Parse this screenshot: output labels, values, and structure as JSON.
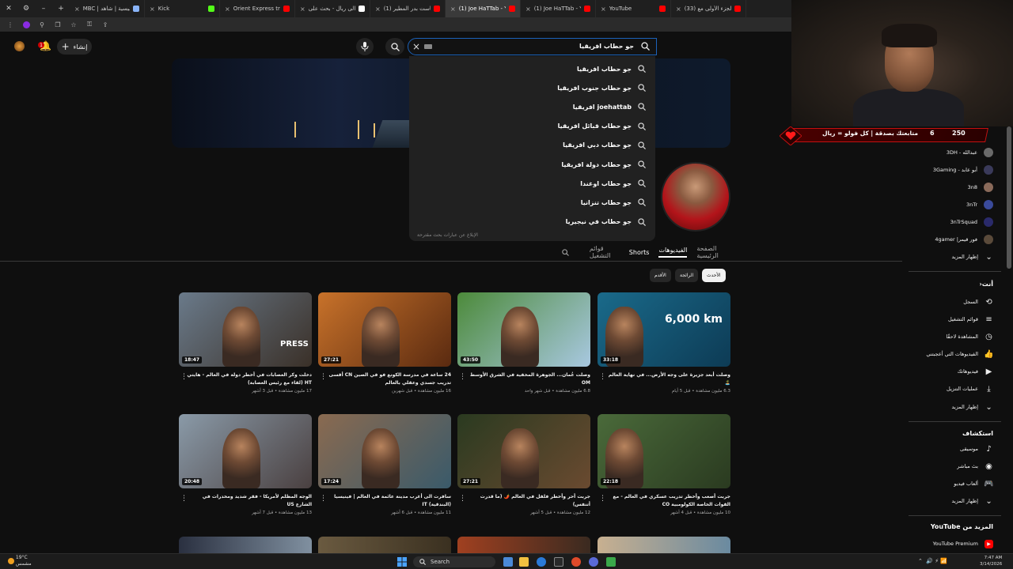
{
  "browser": {
    "tabs": [
      {
        "label": "MBC | الرئيسية | شاهد",
        "color": "#8ab4f8"
      },
      {
        "label": "Kick",
        "color": "#53fc18"
      },
      {
        "label": "Orient Express train li",
        "color": "#ff0000"
      },
      {
        "label": "يورو الى ريال - بحث على",
        "color": "#ffffff"
      },
      {
        "label": "(1) بودكاست بدر المطير",
        "color": "#ff0000"
      },
      {
        "label": "(1) Joe HaTTab - YouTu",
        "color": "#ff0000",
        "active": true
      },
      {
        "label": "(1) Joe HaTTab - YouTu",
        "color": "#ff0000"
      },
      {
        "label": "YouTube",
        "color": "#ff0000"
      },
      {
        "label": "(33) الجزء الأولى مع ...",
        "color": "#ff0000"
      }
    ]
  },
  "header": {
    "create_label": "إنشاء",
    "notif_count": "1"
  },
  "search": {
    "query": "جو حطاب افريقيا",
    "suggestions": [
      "جو حطاب افريقيا",
      "جو حطاب جنوب افريقيا",
      "joehattab افريقيا",
      "جو حطاب قبائل افريقيا",
      "جو حطاب دبي افريقيا",
      "جو حطاب دولة افريقيا",
      "جو حطاب اوغندا",
      "جو حطاب تنزانيا",
      "جو حطاب في نيجيريا"
    ],
    "report_label": "الإبلاغ عن عبارات بحث مقترحة"
  },
  "channel_tabs": [
    "الصفحة الرئيسية",
    "الفيديوهات",
    "Shorts",
    "قوائم التشغيل"
  ],
  "filters": [
    "الأحدث",
    "الرائجة",
    "الأقدم"
  ],
  "videos": [
    {
      "title": "وصلت أبعد جزيرة على وجه الأرض... في نهاية العالم 🏝️",
      "meta": "6.3 مليون مشاهدة • قبل 5 أيام",
      "duration": "33:18",
      "overlay": "6,000 km",
      "colors": [
        "#1a6a8a",
        "#0d3b55"
      ]
    },
    {
      "title": "وصلت عُمان... الجوهرة المخفية في الشرق الأوسط OM",
      "meta": "6.8 مليون مشاهدة • قبل شهر واحد",
      "duration": "43:50",
      "overlay": "",
      "colors": [
        "#4c8a3a",
        "#a8c8e0"
      ]
    },
    {
      "title": "24 ساعة في مدرسة الكونغ فو في الصين CN أقسى تدريب جسدي وعقلي بالعالم",
      "meta": "16 مليون مشاهدة • قبل شهرين",
      "duration": "27:21",
      "overlay": "",
      "colors": [
        "#c8722a",
        "#5a2a10"
      ]
    },
    {
      "title": "دخلت وكر العصابات في أخطر دولة في العالم - هايتي HT (لقاء مع رئيس العصابة)",
      "meta": "17 مليون مشاهدة • قبل 3 أشهر",
      "duration": "18:47",
      "overlay": "PRESS",
      "colors": [
        "#6a7a8a",
        "#3a3028"
      ]
    },
    {
      "title": "جربت أصعب وأخطر تدريب عسكري في العالم - مع القوات الخاصة الكولومبية CO",
      "meta": "10 مليون مشاهدة • قبل 4 أشهر",
      "duration": "22:18",
      "overlay": "",
      "colors": [
        "#4a6a3a",
        "#2a3a20"
      ]
    },
    {
      "title": "جربت أحر وأخطر فلفل في العالم 🌶️ (ما قدرت أتنفس)",
      "meta": "12 مليون مشاهدة • قبل 5 أشهر",
      "duration": "27:21",
      "overlay": "",
      "colors": [
        "#2a3a20",
        "#6a4a30"
      ]
    },
    {
      "title": "سافرت الى أغرب مدينة عائمة في العالم | فينيسيا (البندقية) IT",
      "meta": "11 مليون مشاهدة • قبل 6 أشهر",
      "duration": "17:24",
      "overlay": "",
      "colors": [
        "#8a6a50",
        "#3a5a6a"
      ]
    },
    {
      "title": "الوجه المظلم لأمريكا - فقر شديد ومخدرات في الشارع US",
      "meta": "13 مليون مشاهدة • قبل 7 أشهر",
      "duration": "20:48",
      "overlay": "",
      "colors": [
        "#8a9aa8",
        "#4a4040"
      ]
    }
  ],
  "sidebar": {
    "subs": [
      {
        "label": "عبدالله - 3DH",
        "color": "#6a6a6a"
      },
      {
        "label": "أبو عابد - 3Gaming",
        "color": "#3a3a5a"
      },
      {
        "label": "3n8",
        "color": "#8a6a5a"
      },
      {
        "label": "3nTr",
        "color": "#3a4a9a"
      },
      {
        "label": "3nTrSquad",
        "color": "#2a2a6a"
      },
      {
        "label": "فور قيمر| 4gamer",
        "color": "#5a4a3a"
      }
    ],
    "show_more": "إظهار المزيد",
    "you_heading": "أنت",
    "you_items": [
      {
        "label": "السجل",
        "icon": "history-icon"
      },
      {
        "label": "قوائم التشغيل",
        "icon": "playlists-icon"
      },
      {
        "label": "المشاهدة لاحقًا",
        "icon": "watch-later-icon"
      },
      {
        "label": "الفيديوهات التي أعجبتني",
        "icon": "like-icon"
      },
      {
        "label": "فيديوهاتك",
        "icon": "your-videos-icon"
      },
      {
        "label": "عمليات التنزيل",
        "icon": "download-icon"
      }
    ],
    "explore_heading": "استكشاف",
    "explore_items": [
      {
        "label": "موسيقى",
        "icon": "music-icon"
      },
      {
        "label": "بث مباشر",
        "icon": "live-icon"
      },
      {
        "label": "ألعاب فيديو",
        "icon": "gaming-icon"
      }
    ],
    "more_heading": "المزيد من YouTube",
    "premium": "YouTube Premium"
  },
  "stream_alert": {
    "text": "متابعتك بصدقة | كل فولو = ريال",
    "count": "6",
    "total": "250"
  },
  "taskbar": {
    "weather_temp": "19°C",
    "weather_desc": "مشمس",
    "search_label": "Search",
    "time": "7:47 AM",
    "date": "3/14/2026"
  },
  "colors": {
    "brand": "#ff0000",
    "accent": "#1c62b9",
    "alert": "#c41010"
  }
}
